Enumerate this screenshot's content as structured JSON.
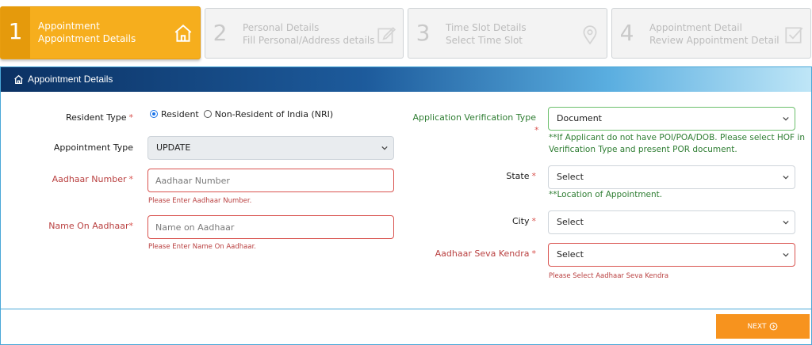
{
  "steps": [
    {
      "num": "1",
      "title": "Appointment",
      "subtitle": "Appointment Details",
      "icon": "home-icon",
      "active": true
    },
    {
      "num": "2",
      "title": "Personal Details",
      "subtitle": "Fill Personal/Address details",
      "icon": "edit-icon",
      "active": false
    },
    {
      "num": "3",
      "title": "Time Slot Details",
      "subtitle": "Select Time Slot",
      "icon": "location-pin-icon",
      "active": false
    },
    {
      "num": "4",
      "title": "Appointment Detail",
      "subtitle": "Review Appointment Detail",
      "icon": "checkbox-icon",
      "active": false
    }
  ],
  "panel": {
    "title": "Appointment Details",
    "icon": "home-icon"
  },
  "form": {
    "resident_type": {
      "label": "Resident Type",
      "required": "*",
      "options": [
        "Resident",
        "Non-Resident of India (NRI)"
      ],
      "selected": "Resident"
    },
    "appointment_type": {
      "label": "Appointment Type",
      "value": "UPDATE"
    },
    "aadhaar_number": {
      "label": "Aadhaar Number",
      "required": "*",
      "placeholder": "Aadhaar Number",
      "error": "Please Enter Aadhaar Number."
    },
    "name_on_aadhaar": {
      "label": "Name On Aadhaar",
      "required": "*",
      "placeholder": "Name on Aadhaar",
      "error": "Please Enter Name On Aadhaar."
    },
    "verification_type": {
      "label": "Application Verification Type",
      "required": "*",
      "value": "Document",
      "note": "**If Applicant do not have POI/POA/DOB. Please select HOF in Verification Type and present POR document."
    },
    "state": {
      "label": "State",
      "required": "*",
      "value": "Select",
      "note": "**Location of Appointment."
    },
    "city": {
      "label": "City",
      "required": "*",
      "value": "Select"
    },
    "seva_kendra": {
      "label": "Aadhaar Seva Kendra",
      "required": "*",
      "value": "Select",
      "error": "Please Select Aadhaar Seva Kendra"
    }
  },
  "footer": {
    "next_label": "NEXT",
    "next_icon": "arrow-circle-right-icon"
  },
  "colors": {
    "active_step": "#f6ae1d",
    "header_start": "#0b3163",
    "next_button": "#f7931e",
    "error": "#d9534f",
    "note": "#2e7d32"
  }
}
